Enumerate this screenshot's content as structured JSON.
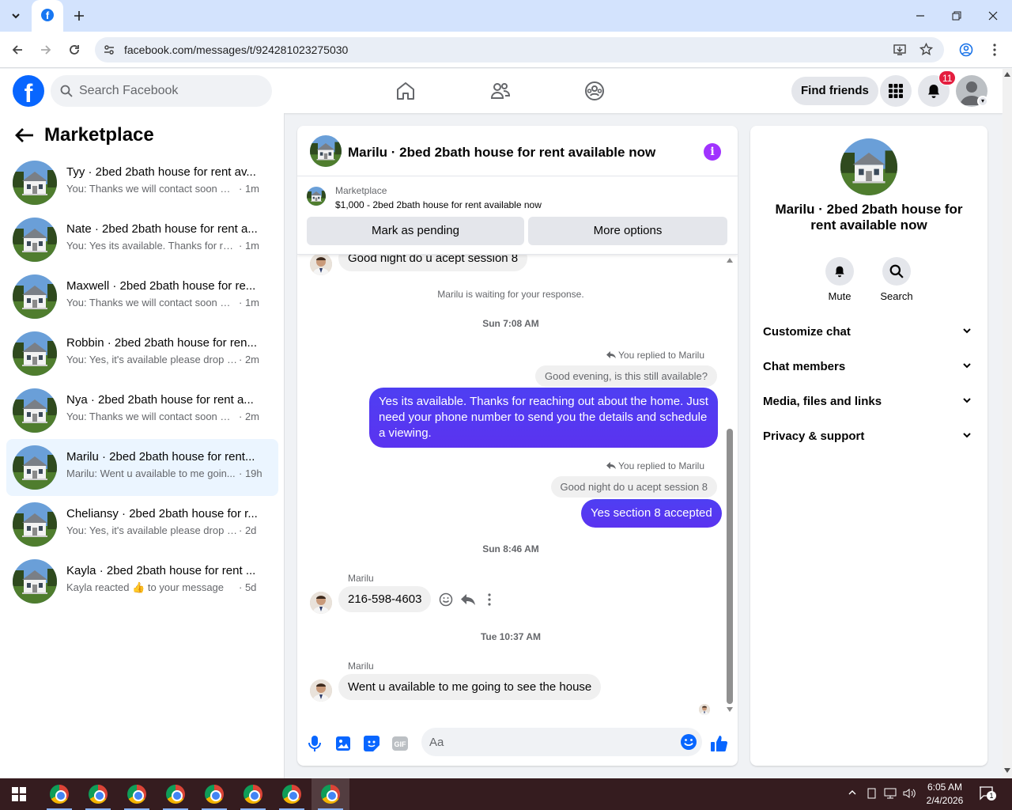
{
  "browser": {
    "url": "facebook.com/messages/t/924281023275030",
    "tab_icon": "facebook-icon"
  },
  "header": {
    "search_placeholder": "Search Facebook",
    "find_friends": "Find friends",
    "notification_count": "11"
  },
  "sidebar": {
    "title": "Marketplace",
    "conversations": [
      {
        "name": "Tyy · 2bed 2bath house for rent av...",
        "preview": "You: Thanks we will contact soon wit...",
        "time": "· 1m"
      },
      {
        "name": "Nate · 2bed 2bath house for rent a...",
        "preview": "You: Yes its available. Thanks for reac...",
        "time": "· 1m"
      },
      {
        "name": "Maxwell · 2bed 2bath house for re...",
        "preview": "You: Thanks we will contact soon wit...",
        "time": "· 1m"
      },
      {
        "name": "Robbin · 2bed 2bath house for ren...",
        "preview": "You: Yes, it's available please drop yo...",
        "time": "· 2m"
      },
      {
        "name": "Nya · 2bed 2bath house for rent a...",
        "preview": "You: Thanks we will contact soon wit...",
        "time": "· 2m"
      },
      {
        "name": "Marilu · 2bed 2bath house for rent...",
        "preview": "Marilu: Went u available to me goin...",
        "time": "· 19h"
      },
      {
        "name": "Cheliansy · 2bed 2bath house for r...",
        "preview": "You: Yes, it's available please drop you...",
        "time": "· 2d"
      },
      {
        "name": "Kayla · 2bed 2bath house for rent ...",
        "preview": "Kayla reacted 👍 to your message",
        "time": "· 5d"
      }
    ]
  },
  "chat": {
    "title": "Marilu · 2bed 2bath house for rent available now",
    "listing_label": "Marketplace",
    "listing_text": "$1,000 - 2bed 2bath house for rent available now",
    "mark_pending": "Mark as pending",
    "more_options": "More options",
    "msg_top": "Good night do u acept session 8",
    "waiting": "Marilu is waiting for your response.",
    "stamp1": "Sun 7:08 AM",
    "replied1": "You replied to Marilu",
    "reply_ctx1": "Good evening, is this still available?",
    "out1": "Yes its available. Thanks for reaching out about the home. Just need your phone number to send you the details and schedule a viewing.",
    "replied2": "You replied to Marilu",
    "reply_ctx2": "Good night do u acept session 8",
    "out2": "Yes section 8 accepted",
    "stamp2": "Sun 8:46 AM",
    "sender1": "Marilu",
    "in_phone": "216-598-4603",
    "stamp3": "Tue 10:37 AM",
    "sender2": "Marilu",
    "in_last": "Went u available to me going to see the house",
    "input_placeholder": "Aa"
  },
  "details": {
    "name": "Marilu · 2bed 2bath house for rent available now",
    "mute": "Mute",
    "search": "Search",
    "sections": [
      "Customize chat",
      "Chat members",
      "Media, files and links",
      "Privacy & support"
    ]
  },
  "taskbar": {
    "time": "6:05 AM",
    "date": "2/4/2026",
    "notif": "1"
  }
}
